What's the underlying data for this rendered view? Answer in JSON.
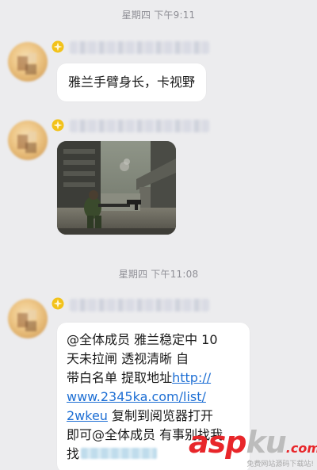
{
  "chat": {
    "timestamps": [
      "星期四 下午9:11",
      "星期四 下午11:08"
    ],
    "messages": [
      {
        "type": "text",
        "text": "雅兰手臂身长，卡视野"
      },
      {
        "type": "image",
        "description": ""
      },
      {
        "type": "text",
        "lines": [
          "@全体成员 雅兰稳定中  10",
          "天未拉闸   透视清晰   自",
          "带白名单  提取地址",
          "复制到阅览器打开",
          "即可@全体成员 有事别找我",
          "找"
        ],
        "link_parts": [
          "http://",
          "www.2345ka.com/list/",
          "2wkeu"
        ]
      }
    ]
  },
  "badge_color": "#f2c21a",
  "link_color": "#1e6fd4",
  "watermark": {
    "main_a": "asp",
    "main_b": "ku",
    "main_c": ".com",
    "sub": "免费网站源码下载站!"
  }
}
